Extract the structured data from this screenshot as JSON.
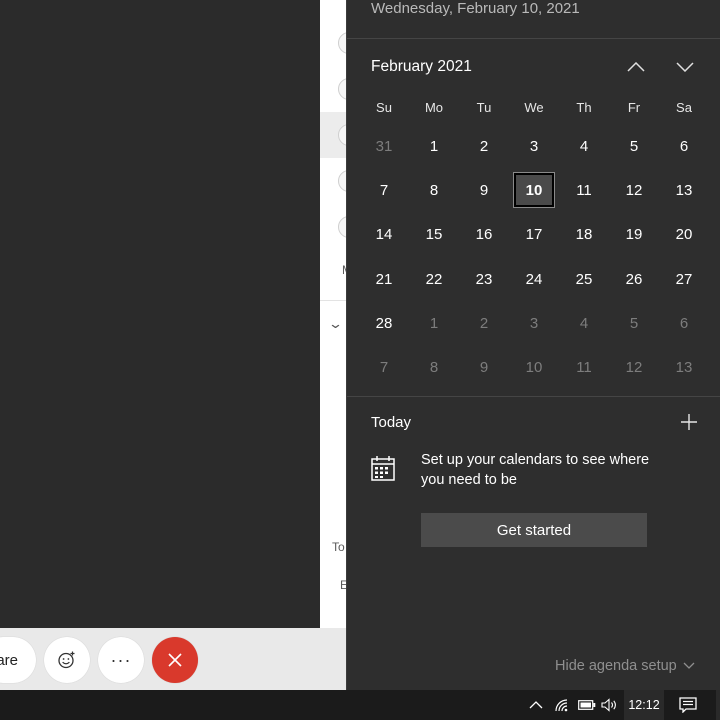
{
  "background_app": {
    "share_label": "are",
    "fragment_1": "M",
    "fragment_2": "To",
    "fragment_3": "E"
  },
  "calendar": {
    "date_header": "Wednesday, February 10, 2021",
    "month_label": "February 2021",
    "days_of_week": [
      "Su",
      "Mo",
      "Tu",
      "We",
      "Th",
      "Fr",
      "Sa"
    ],
    "weeks": [
      [
        "31",
        "1",
        "2",
        "3",
        "4",
        "5",
        "6"
      ],
      [
        "7",
        "8",
        "9",
        "10",
        "11",
        "12",
        "13"
      ],
      [
        "14",
        "15",
        "16",
        "17",
        "18",
        "19",
        "20"
      ],
      [
        "21",
        "22",
        "23",
        "24",
        "25",
        "26",
        "27"
      ],
      [
        "28",
        "1",
        "2",
        "3",
        "4",
        "5",
        "6"
      ],
      [
        "7",
        "8",
        "9",
        "10",
        "11",
        "12",
        "13"
      ]
    ],
    "selected_day": "10"
  },
  "agenda": {
    "today_label": "Today",
    "setup_text": "Set up your calendars to see where you need to be",
    "get_started_label": "Get started",
    "hide_agenda_label": "Hide agenda setup"
  },
  "taskbar": {
    "clock": "12:12"
  },
  "colors": {
    "flyout_bg": "#2e2e2e",
    "hangup_red": "#d9392c",
    "taskbar_bg": "#1b1b1b"
  }
}
